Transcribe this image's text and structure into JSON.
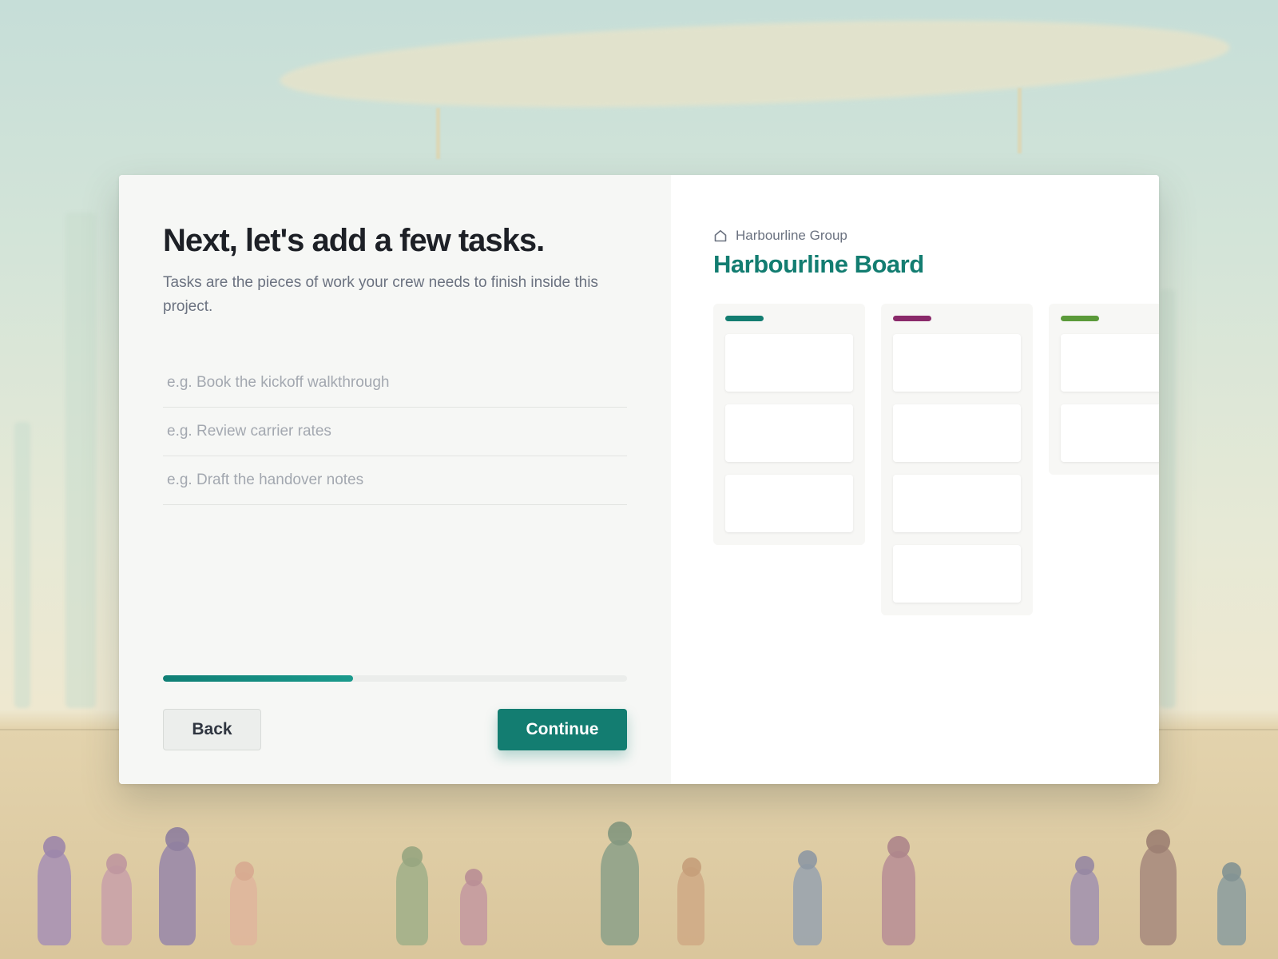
{
  "task_step": {
    "title": "Next, let's add a few tasks.",
    "subtitle": "Tasks are the pieces of work your crew needs to finish inside this project.",
    "task_placeholders": [
      "e.g. Book the kickoff walkthrough",
      "e.g. Review carrier rates",
      "e.g. Draft the handover notes"
    ],
    "progress_fraction": 0.41,
    "back_label": "Back",
    "continue_label": "Continue"
  },
  "board_preview": {
    "workspace_name": "Harbourline Group",
    "workspace_icon": "home-icon",
    "board_name": "Harbourline Board",
    "columns": [
      {
        "accent": "#137d71",
        "card_count": 3
      },
      {
        "accent": "#8a2a6a",
        "card_count": 4
      },
      {
        "accent": "#5b9a3a",
        "card_count": 2
      }
    ]
  },
  "colors": {
    "brand": "#137d71",
    "text_primary": "#1d2026",
    "text_secondary": "#6b7280"
  }
}
